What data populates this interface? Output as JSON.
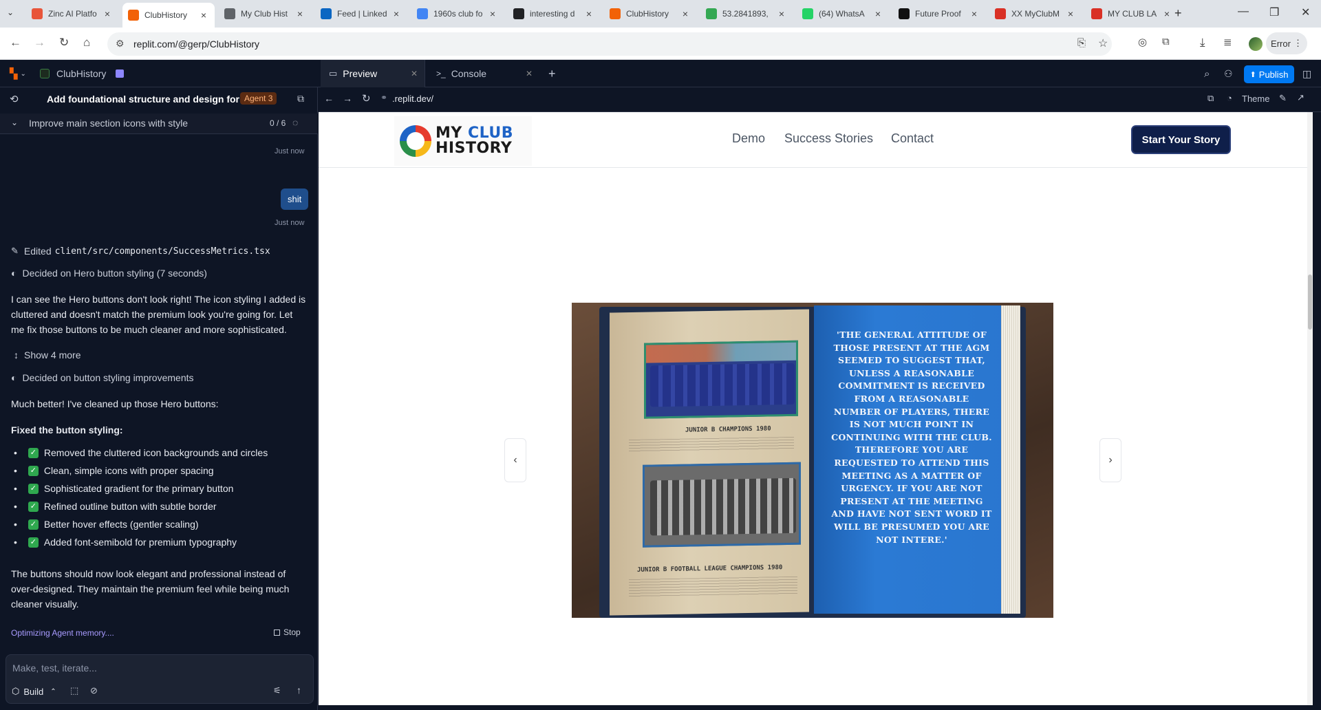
{
  "browser": {
    "tabs": [
      {
        "title": "Zinc AI Platfo",
        "icon": "zinc-icon",
        "color": "#e8553a"
      },
      {
        "title": "ClubHistory",
        "icon": "replit-icon",
        "color": "#f26207",
        "active": true
      },
      {
        "title": "My Club Hist",
        "icon": "globe-icon",
        "color": "#5f6368"
      },
      {
        "title": "Feed | Linked",
        "icon": "linkedin-icon",
        "color": "#0a66c2"
      },
      {
        "title": "1960s club fo",
        "icon": "google-icon",
        "color": "#4285f4"
      },
      {
        "title": "interesting d",
        "icon": "app-icon",
        "color": "#202124"
      },
      {
        "title": "ClubHistory",
        "icon": "replit-icon",
        "color": "#f26207"
      },
      {
        "title": "53.2841893,",
        "icon": "maps-icon",
        "color": "#34a853"
      },
      {
        "title": "(64) WhatsA",
        "icon": "whatsapp-icon",
        "color": "#25d366"
      },
      {
        "title": "Future Proof",
        "icon": "app-icon",
        "color": "#111111"
      },
      {
        "title": "XX MyClubM",
        "icon": "pdf-icon",
        "color": "#d93025"
      },
      {
        "title": "MY CLUB LA",
        "icon": "pdf-icon",
        "color": "#d93025"
      }
    ],
    "new_tab": "+",
    "url": "replit.com/@gerp/ClubHistory",
    "error_label": "Error"
  },
  "replit": {
    "project_name": "ClubHistory",
    "preview_tab": "Preview",
    "console_tab": "Console",
    "publish_label": "Publish",
    "preview_url": ".replit.dev/",
    "theme_label": "Theme"
  },
  "chat": {
    "title": "Add foundational structure and design for ...",
    "agent_badge": "Agent 3",
    "task_title": "Improve main section icons with style",
    "task_progress": "0 / 6",
    "time1": "Just now",
    "user_message": "shit",
    "time2": "Just now",
    "edited_prefix": "Edited",
    "edited_file": "client/src/components/SuccessMetrics.tsx",
    "decided1": "Decided on Hero button styling (7 seconds)",
    "para1": "I can see the Hero buttons don't look right! The icon styling I added is cluttered and doesn't match the premium look you're going for. Let me fix those buttons to be much cleaner and more sophisticated.",
    "show_more": "Show 4 more",
    "decided2": "Decided on button styling improvements",
    "para2": "Much better! I've cleaned up those Hero buttons:",
    "heading": "Fixed the button styling:",
    "bullets": [
      "Removed the cluttered icon backgrounds and circles",
      "Clean, simple icons with proper spacing",
      "Sophisticated gradient for the primary button",
      "Refined outline button with subtle border",
      "Better hover effects (gentler scaling)",
      "Added font-semibold for premium typography"
    ],
    "para3": "The buttons should now look elegant and professional instead of over-designed. They maintain the premium feel while being much cleaner visually.",
    "status": "Optimizing Agent memory....",
    "stop_label": "Stop",
    "input_placeholder": "Make, test, iterate...",
    "build_label": "Build"
  },
  "site": {
    "logo_line1_a": "MY ",
    "logo_line1_b": "CLUB",
    "logo_line2": "HISTORY",
    "nav": [
      "Demo",
      "Success Stories",
      "Contact"
    ],
    "cta": "Start Your Story",
    "prev_arrow": "‹",
    "next_arrow": "›",
    "book": {
      "caption_top": "JUNIOR B CHAMPIONS 1980",
      "caption_bottom": "JUNIOR B FOOTBALL LEAGUE CHAMPIONS 1980",
      "quote": "'THE GENERAL ATTITUDE OF THOSE PRESENT AT THE AGM SEEMED TO SUGGEST THAT, UNLESS A REASONABLE COMMITMENT IS RECEIVED FROM A REASONABLE NUMBER OF PLAYERS, THERE IS NOT MUCH POINT IN CONTINUING WITH THE CLUB. THEREFORE YOU ARE REQUESTED TO ATTEND THIS MEETING AS A MATTER OF URGENCY. IF YOU ARE NOT PRESENT AT THE MEETING AND HAVE NOT SENT WORD IT WILL BE PRESUMED YOU ARE NOT INTERE.'"
    }
  }
}
